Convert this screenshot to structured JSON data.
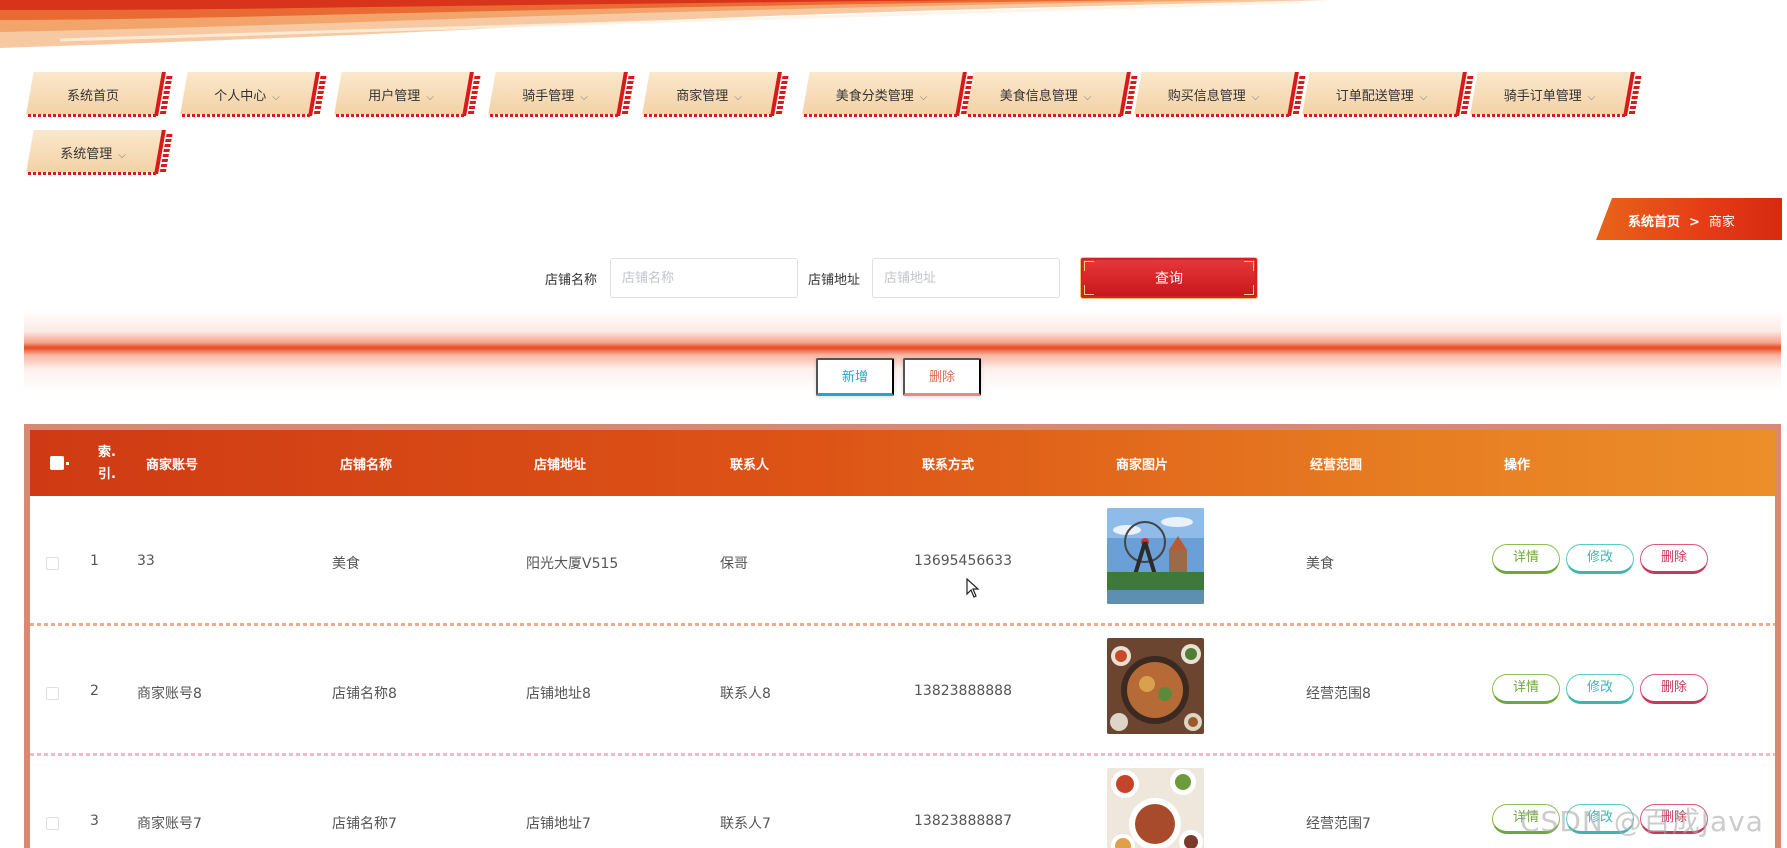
{
  "nav": {
    "items": [
      {
        "label": "系统首页",
        "dropdown": false
      },
      {
        "label": "个人中心",
        "dropdown": true
      },
      {
        "label": "用户管理",
        "dropdown": true
      },
      {
        "label": "骑手管理",
        "dropdown": true
      },
      {
        "label": "商家管理",
        "dropdown": true
      },
      {
        "label": "美食分类管理",
        "dropdown": true
      },
      {
        "label": "美食信息管理",
        "dropdown": true
      },
      {
        "label": "购买信息管理",
        "dropdown": true
      },
      {
        "label": "订单配送管理",
        "dropdown": true
      },
      {
        "label": "骑手订单管理",
        "dropdown": true
      },
      {
        "label": "系统管理",
        "dropdown": true
      }
    ]
  },
  "breadcrumb": {
    "home": "系统首页",
    "separator": ">",
    "current": "商家"
  },
  "search": {
    "shop_name_label": "店铺名称",
    "shop_name_placeholder": "店铺名称",
    "shop_name_value": "",
    "shop_address_label": "店铺地址",
    "shop_address_placeholder": "店铺地址",
    "shop_address_value": "",
    "query_label": "查询"
  },
  "actions": {
    "add_label": "新增",
    "delete_label": "删除"
  },
  "table": {
    "columns": [
      "索引",
      "商家账号",
      "店铺名称",
      "店铺地址",
      "联系人",
      "联系方式",
      "商家图片",
      "经营范围",
      "操作"
    ],
    "index_header_lines": [
      "索.",
      "引."
    ],
    "rows": [
      {
        "index": "1",
        "account": "33",
        "shop_name": "美食",
        "address": "阳光大厦V515",
        "contact": "保哥",
        "phone": "13695456633",
        "image": "amusement-park-photo",
        "scope": "美食"
      },
      {
        "index": "2",
        "account": "商家账号8",
        "shop_name": "店铺名称8",
        "address": "店铺地址8",
        "contact": "联系人8",
        "phone": "13823888888",
        "image": "food-platter-photo",
        "scope": "经营范围8"
      },
      {
        "index": "3",
        "account": "商家账号7",
        "shop_name": "店铺名称7",
        "address": "店铺地址7",
        "contact": "联系人7",
        "phone": "13823888887",
        "image": "dishes-photo",
        "scope": "经营范围7"
      }
    ],
    "row_actions": {
      "detail": "详情",
      "edit": "修改",
      "delete": "删除"
    }
  },
  "watermark": "CSDN @百成Java",
  "colors": {
    "accent_red": "#d81a1a",
    "header_orange": "#e77e22",
    "detail_green": "#6ea837",
    "edit_teal": "#3bb7b3",
    "delete_pink": "#c8385a"
  }
}
